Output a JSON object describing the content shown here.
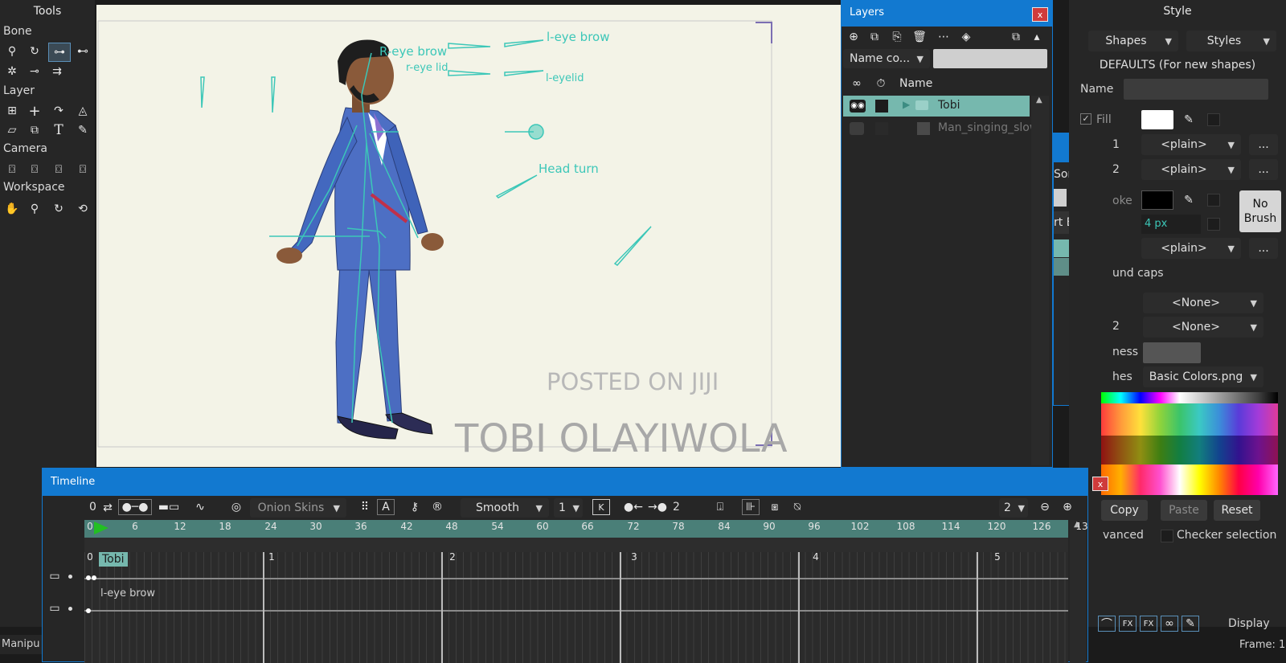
{
  "tools_panel": {
    "title": "Tools",
    "sections": [
      {
        "label": "Bone",
        "icons": [
          "select-bone-icon",
          "add-bone-icon",
          "transform-bone-icon",
          "reparent-bone-icon",
          "bone-strength-icon",
          "manipulate-bones-icon",
          "bind-layer-icon"
        ]
      },
      {
        "label": "Layer",
        "icons": [
          "set-origin-icon",
          "translate-layer-icon",
          "rotate-layer-icon",
          "scale-layer-icon",
          "shear-layer-icon",
          "flip-layer-icon",
          "text-icon",
          "eyedropper-icon"
        ]
      },
      {
        "label": "Camera",
        "icons": [
          "track-camera-icon",
          "zoom-camera-icon",
          "roll-camera-icon",
          "pan-tilt-camera-icon"
        ]
      },
      {
        "label": "Workspace",
        "icons": [
          "hand-icon",
          "magnify-icon",
          "rotate-workspace-icon",
          "orbit-icon"
        ]
      }
    ]
  },
  "canvas": {
    "rig_labels": {
      "r_eye_brow": "R-eye brow",
      "r_eye_lid": "r-eye lid",
      "l_eye_brow": "l-eye brow",
      "l_eyelid": "l-eyelid",
      "head_turn": "Head turn"
    },
    "watermark_line1": "POSTED ON JIJI",
    "watermark_line2": "TOBI OLAYIWOLA"
  },
  "layers_panel": {
    "title": "Layers",
    "close_label": "x",
    "filter_dropdown": "Name co...",
    "column_name": "Name",
    "layers": [
      {
        "name": "Tobi",
        "selected": true
      },
      {
        "name": "Man_singing_slow",
        "selected": false
      }
    ]
  },
  "hidden_panel": {
    "close_label": "x",
    "partial_sort": "Sort",
    "partial_tab": "rt Bones"
  },
  "style_panel": {
    "title": "Style",
    "shapes_dropdown": "Shapes",
    "styles_dropdown": "Styles",
    "defaults_text": "DEFAULTS (For new shapes)",
    "name_label": "Name",
    "fill_label": "Fill",
    "effect1_partial": "1",
    "effect2_partial": "2",
    "plain": "<plain>",
    "more": "...",
    "stroke_label_partial": "oke",
    "width_value": "4 px",
    "no_brush": "No Brush",
    "round_caps_partial": "und caps",
    "none": "<None>",
    "partial_2": "2",
    "brightness_partial": "ness",
    "swatches_partial": "hes",
    "swatches_value": "Basic Colors.png",
    "copy": "Copy",
    "paste": "Paste",
    "reset": "Reset",
    "advanced_partial": "vanced",
    "checker_selection": "Checker selection",
    "display": "Display",
    "frame_partial": "Frame: 1",
    "fill_color": "#ffffff",
    "stroke_color": "#000000"
  },
  "timeline": {
    "title": "Timeline",
    "close_label": "x",
    "frame_value": "0",
    "onion_skins": "Onion Skins",
    "interpolation": "Smooth",
    "interp_value": "1",
    "nudge_value": "2",
    "zoom_value": "2",
    "frame_ticks": [
      "0",
      "6",
      "12",
      "18",
      "24",
      "30",
      "36",
      "42",
      "48",
      "54",
      "60",
      "66",
      "72",
      "78",
      "84",
      "90",
      "96",
      "102",
      "108",
      "114",
      "120",
      "126",
      "13"
    ],
    "second_ticks": [
      "0",
      "1",
      "2",
      "3",
      "4",
      "5"
    ],
    "track_layer": "Tobi",
    "bone_track": "l-eye brow"
  },
  "status_bar": {
    "text": "Manipu"
  },
  "colors": {
    "accent_blue": "#1279d0",
    "rig_teal": "#3cc7b8",
    "selected_row": "#76b8ae",
    "canvas_bg": "#f3f3e7",
    "suit_blue": "#4d6fc4",
    "close_red": "#cf3b3b"
  }
}
